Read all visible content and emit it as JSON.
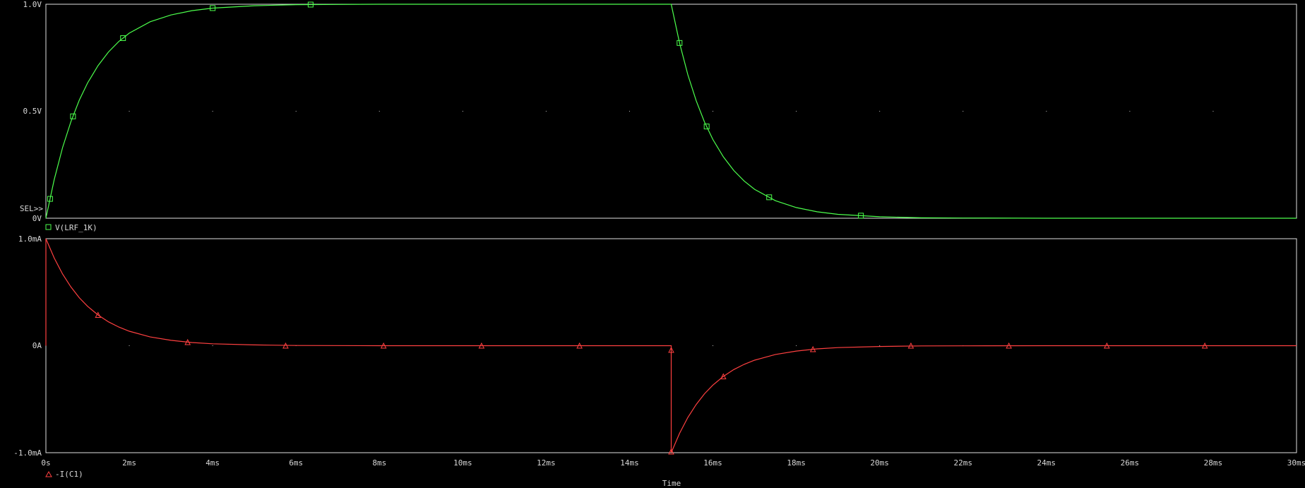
{
  "chart_data": [
    {
      "type": "line",
      "ylim": [
        0,
        1.0
      ],
      "y_ticks": [
        {
          "value": 0,
          "label": "0V"
        },
        {
          "value": 0.5,
          "label": "0.5V"
        },
        {
          "value": 1.0,
          "label": "1.0V"
        }
      ],
      "grid": "dotted",
      "selected_marker": "SEL>>",
      "series": [
        {
          "name": "V(LRF_1K)",
          "color": "#4cff4c",
          "marker": "square",
          "x": [
            0,
            0.2,
            0.4,
            0.6,
            0.8,
            1.0,
            1.25,
            1.5,
            1.75,
            2.0,
            2.5,
            3.0,
            3.5,
            4.0,
            5.0,
            6.0,
            7.0,
            8.0,
            10.0,
            12.0,
            14.0,
            15.0,
            15.2,
            15.4,
            15.6,
            15.8,
            16.0,
            16.25,
            16.5,
            16.75,
            17.0,
            17.5,
            18.0,
            18.5,
            19.0,
            20.0,
            21.0,
            22.0,
            24.0,
            26.0,
            28.0,
            30.0
          ],
          "values": [
            0,
            0.181,
            0.33,
            0.451,
            0.551,
            0.632,
            0.713,
            0.777,
            0.826,
            0.865,
            0.918,
            0.95,
            0.97,
            0.982,
            0.993,
            0.998,
            0.999,
            1.0,
            1.0,
            1.0,
            1.0,
            1.0,
            0.819,
            0.67,
            0.549,
            0.449,
            0.368,
            0.287,
            0.223,
            0.174,
            0.135,
            0.082,
            0.05,
            0.03,
            0.018,
            0.007,
            0.002,
            0.001,
            0,
            0,
            0,
            0
          ],
          "marker_x": [
            0.1,
            0.65,
            1.85,
            4.0,
            6.35,
            15.2,
            15.85,
            17.35,
            19.55
          ]
        }
      ]
    },
    {
      "type": "line",
      "ylim": [
        -1.0,
        1.0
      ],
      "y_ticks": [
        {
          "value": -1.0,
          "label": "-1.0mA"
        },
        {
          "value": 0,
          "label": "0A"
        },
        {
          "value": 1.0,
          "label": "1.0mA"
        }
      ],
      "x_ticks": [
        "0s",
        "2ms",
        "4ms",
        "6ms",
        "8ms",
        "10ms",
        "12ms",
        "14ms",
        "16ms",
        "18ms",
        "20ms",
        "22ms",
        "24ms",
        "26ms",
        "28ms",
        "30ms"
      ],
      "xlim": [
        0,
        30
      ],
      "xlabel": "Time",
      "grid": "dotted",
      "series": [
        {
          "name": "-I(C1)",
          "color": "#ff4040",
          "marker": "triangle",
          "x": [
            0,
            0,
            0.2,
            0.4,
            0.6,
            0.8,
            1.0,
            1.25,
            1.5,
            1.75,
            2.0,
            2.5,
            3.0,
            3.5,
            4.0,
            5.0,
            6.0,
            8.0,
            10.0,
            12.0,
            14.0,
            15.0,
            15.0,
            15.2,
            15.4,
            15.6,
            15.8,
            16.0,
            16.25,
            16.5,
            16.75,
            17.0,
            17.5,
            18.0,
            18.5,
            19.0,
            20.0,
            21.0,
            22.0,
            24.0,
            26.0,
            28.0,
            30.0
          ],
          "values": [
            0,
            1.0,
            0.819,
            0.67,
            0.549,
            0.449,
            0.368,
            0.287,
            0.223,
            0.174,
            0.135,
            0.082,
            0.05,
            0.03,
            0.018,
            0.007,
            0.002,
            0,
            0,
            0,
            0,
            0,
            -1.0,
            -0.819,
            -0.67,
            -0.549,
            -0.449,
            -0.368,
            -0.287,
            -0.223,
            -0.174,
            -0.135,
            -0.082,
            -0.05,
            -0.03,
            -0.018,
            -0.007,
            -0.002,
            -0.001,
            0,
            0,
            0,
            0
          ],
          "markers": [
            {
              "x": 1.25,
              "y": 0.287
            },
            {
              "x": 3.4,
              "y": 0.033
            },
            {
              "x": 5.75,
              "y": 0
            },
            {
              "x": 8.1,
              "y": 0
            },
            {
              "x": 10.45,
              "y": 0
            },
            {
              "x": 12.8,
              "y": 0
            },
            {
              "x": 15.0,
              "y": -0.04
            },
            {
              "x": 15.0,
              "y": -0.99
            },
            {
              "x": 16.25,
              "y": -0.287
            },
            {
              "x": 18.4,
              "y": -0.033
            },
            {
              "x": 20.75,
              "y": 0
            },
            {
              "x": 23.1,
              "y": 0
            },
            {
              "x": 25.45,
              "y": 0
            },
            {
              "x": 27.8,
              "y": 0
            }
          ]
        }
      ]
    }
  ]
}
